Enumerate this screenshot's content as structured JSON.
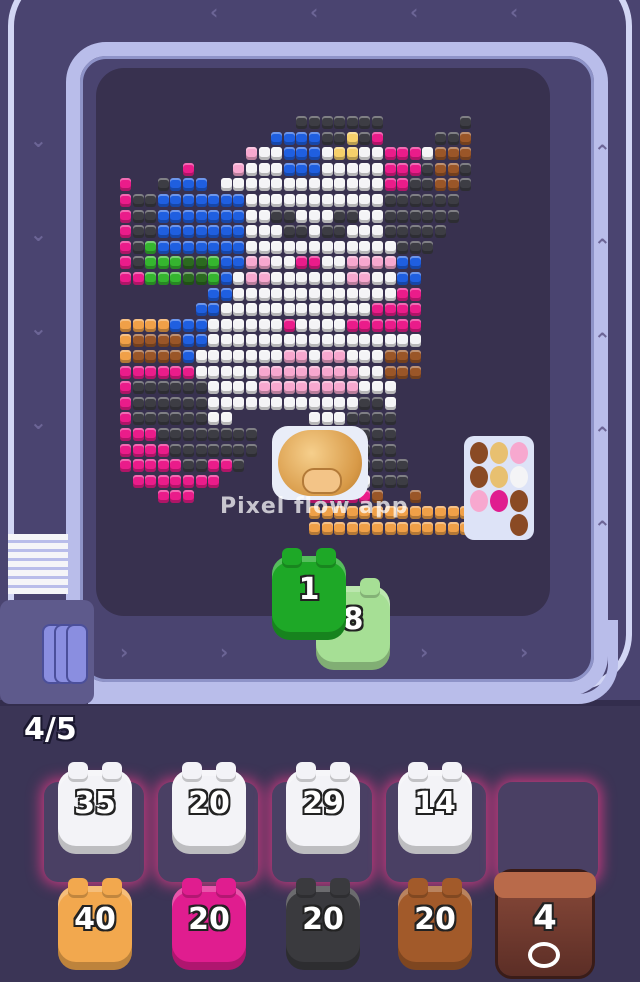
{
  "hud": {
    "level_progress": "4/5"
  },
  "watermark": "Pixel flow app",
  "conveyor_pigs": [
    {
      "number": "1",
      "color": "#1ea827"
    },
    {
      "number": "8",
      "color": "#a6df95"
    }
  ],
  "queue_slots": [
    {
      "number": "35",
      "color": "#f3f3f7"
    },
    {
      "number": "20",
      "color": "#f3f3f7"
    },
    {
      "number": "29",
      "color": "#f3f3f7"
    },
    {
      "number": "14",
      "color": "#f3f3f7"
    },
    {
      "number": "",
      "color": ""
    }
  ],
  "waiting_pigs": [
    {
      "number": "40",
      "color": "#f2a84e"
    },
    {
      "number": "20",
      "color": "#e01d8f"
    },
    {
      "number": "20",
      "color": "#3a3a3e"
    },
    {
      "number": "20",
      "color": "#a25a2a"
    }
  ],
  "locked_crate": {
    "number": "4"
  },
  "palette": {
    "W": "#f4f4f6",
    "K": "#3d3d44",
    "B": "#1f5fe0",
    "P": "#ea1c8a",
    "L": "#f7a8cf",
    "G": "#35b52f",
    "D": "#2b6a1f",
    "O": "#f0a048",
    "N": "#9a5628",
    "T": "#d6a070",
    "Y": "#f6d06b"
  },
  "pixel_art": [
    "..............KKKKKKK......K.",
    "............BBBBKKYKP....KKN.",
    "..........LWWBBBWYYWWPPPWNNN.",
    ".....P...LWWWBBBWWWWWPPPKNNK.",
    "P..KBBB.WWWWWWWWWWWWWPPKKNNK.",
    "PKKBBBBBBBWWWWWWWWWWWKKKKKK.",
    "PKKBBBBBBBWWKKWWWKKWWKKKKKK.",
    "PKKBBBBBBBWWWKKWKKWWWKKKKK..",
    "PKGBBBBBBBWWWWWWWWWWWWKKK...",
    "PKGGGDDGBBLLWWPPWWLLLLBB....",
    "PPGGGDDGBWLLWWWWWWLLWWBB....",
    ".......BBWWWWWWWWWWWWWPP....",
    "......BBWWWWWWWWWWWWPPPP....",
    "OOOOBBBWWWWWWPWWWWPPPPPP....",
    "ONNNNBBWWWWWWWWWWWWWWWWW....",
    "ONNNNBWWWWWWWLLWLLWWWNNN....",
    "PPPPPPWWWWWLLLLLLLLWWNNN....",
    "PKKKKKKWWWWLLLLLLLLWWW......",
    "PKKKKKKWWWWWWWWWWWWKKW......",
    "PKKKKKKWW......WWWKKKK......",
    "PPPKKKKKKKK.....PWWKKK......",
    "PPPPKKKKKKK.....WWKKKK......",
    "PPPPPKKPPK......WWPKKKK.....",
    ".PPPPPPP........WWWWKKK.....",
    "...PPP.........PPPPPN..N....",
    "...............OOOOOOOOOOOOO",
    "...............OOOOOOOOOOOOO"
  ]
}
